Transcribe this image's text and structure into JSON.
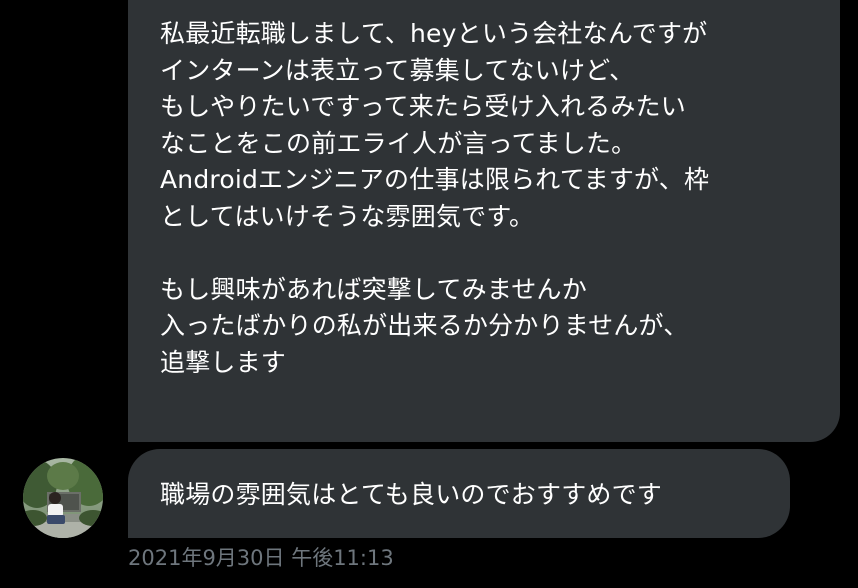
{
  "messages": [
    {
      "lines": [
        "私最近転職しまして、heyという会社なんですが",
        "インターンは表立って募集してないけど、",
        "もしやりたいですって来たら受け入れるみたい",
        "なことをこの前エライ人が言ってました。",
        "Androidエンジニアの仕事は限られてますが、枠",
        "としてはいけそうな雰囲気です。",
        "",
        "もし興味があれば突撃してみませんか",
        "入ったばかりの私が出来るか分かりませんが、",
        "追撃します"
      ]
    },
    {
      "lines": [
        "職場の雰囲気はとても良いのでおすすめです"
      ]
    }
  ],
  "timestamp": "2021年9月30日 午後11:13",
  "colors": {
    "background": "#000000",
    "bubble": "#2f3336",
    "text": "#ffffff",
    "timestamp": "#6e767d"
  },
  "avatar": {
    "icon": "user-avatar-photo"
  }
}
